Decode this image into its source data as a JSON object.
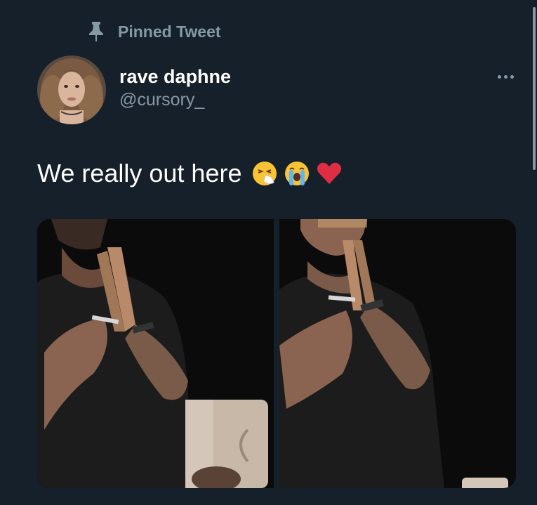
{
  "pinned": {
    "label": "Pinned Tweet",
    "icon": "pin-icon"
  },
  "author": {
    "display_name": "rave daphne",
    "handle": "@cursory_",
    "avatar_icon": "avatar"
  },
  "tweet": {
    "text": "We really out here",
    "emojis": [
      "sneezing-face-icon",
      "loudly-crying-face-icon",
      "red-heart-icon"
    ]
  },
  "menu": {
    "icon": "more-options-icon"
  },
  "media": {
    "count": 2,
    "photos": [
      "praying-hands-photo-left",
      "praying-hands-photo-right"
    ]
  },
  "colors": {
    "background": "#15202b",
    "primary_text": "#ffffff",
    "secondary_text": "#8899a6"
  }
}
